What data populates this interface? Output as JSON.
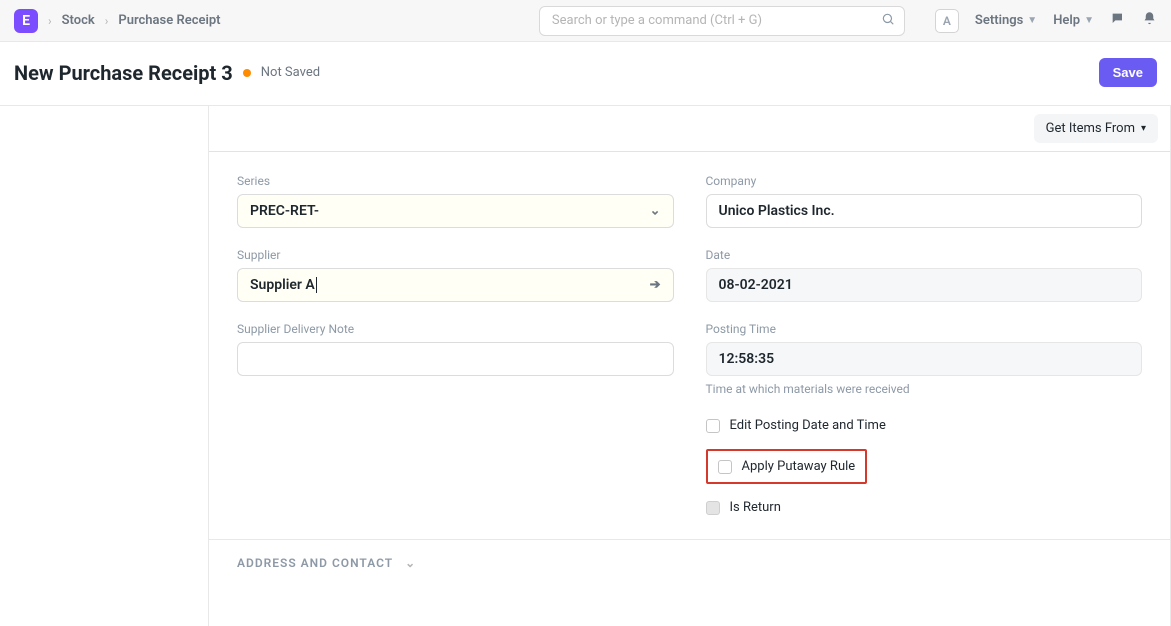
{
  "navbar": {
    "logo_initial": "E",
    "breadcrumb": [
      "Stock",
      "Purchase Receipt"
    ],
    "search_placeholder": "Search or type a command (Ctrl + G)",
    "user_initial": "A",
    "settings_label": "Settings",
    "help_label": "Help"
  },
  "header": {
    "title": "New Purchase Receipt 3",
    "status": "Not Saved",
    "save_label": "Save"
  },
  "toolbar": {
    "get_items_from": "Get Items From"
  },
  "form": {
    "left": {
      "series_label": "Series",
      "series_value": "PREC-RET-",
      "supplier_label": "Supplier",
      "supplier_value": "Supplier A",
      "delivery_note_label": "Supplier Delivery Note",
      "delivery_note_value": ""
    },
    "right": {
      "company_label": "Company",
      "company_value": "Unico Plastics Inc.",
      "date_label": "Date",
      "date_value": "08-02-2021",
      "posting_time_label": "Posting Time",
      "posting_time_value": "12:58:35",
      "posting_time_help": "Time at which materials were received",
      "check_edit_label": "Edit Posting Date and Time",
      "check_putaway_label": "Apply Putaway Rule",
      "check_return_label": "Is Return"
    }
  },
  "section": {
    "address_contact": "ADDRESS AND CONTACT"
  }
}
